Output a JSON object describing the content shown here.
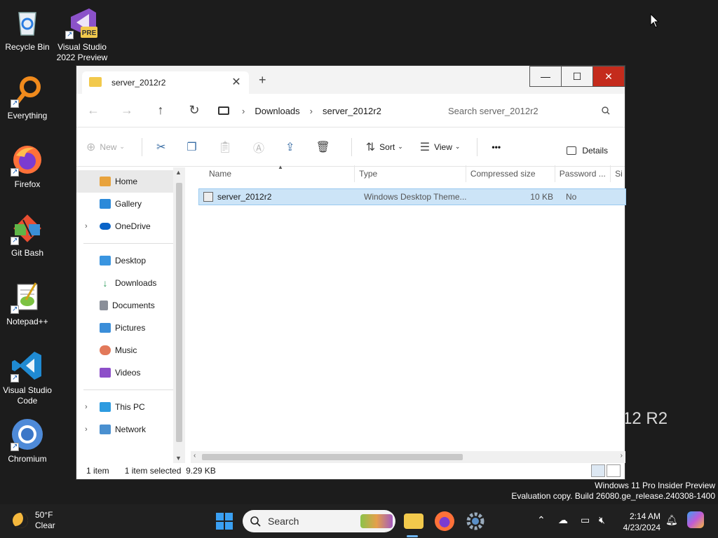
{
  "desktop": {
    "icons": [
      {
        "label": "Recycle Bin"
      },
      {
        "label": "Visual Studio 2022 Preview",
        "badge": "PRE"
      },
      {
        "label": "Everything"
      },
      {
        "label": "Firefox"
      },
      {
        "label": "Git Bash"
      },
      {
        "label": "Notepad++"
      },
      {
        "label": "Visual Studio Code"
      },
      {
        "label": "Chromium"
      }
    ],
    "background_text": "12 R2",
    "watermark_line1": "Windows 11 Pro Insider Preview",
    "watermark_line2": "Evaluation copy. Build 26080.ge_release.240308-1400"
  },
  "window": {
    "tab_title": "server_2012r2",
    "new_tab": "+",
    "buttons": {
      "minimize": "—",
      "maximize": "☐",
      "close": "✕"
    },
    "breadcrumbs": [
      "Downloads",
      "server_2012r2"
    ],
    "search_placeholder": "Search server_2012r2",
    "toolbar": {
      "new": "New",
      "sort": "Sort",
      "view": "View",
      "more": "•••",
      "details": "Details"
    },
    "nav": {
      "home": "Home",
      "gallery": "Gallery",
      "onedrive": "OneDrive",
      "desktop": "Desktop",
      "downloads": "Downloads",
      "documents": "Documents",
      "pictures": "Pictures",
      "music": "Music",
      "videos": "Videos",
      "thispc": "This PC",
      "network": "Network"
    },
    "columns": [
      "Name",
      "Type",
      "Compressed size",
      "Password ...",
      "Si"
    ],
    "files": [
      {
        "name": "server_2012r2",
        "type": "Windows Desktop Theme...",
        "size": "10 KB",
        "password": "No"
      }
    ],
    "status": {
      "count": "1 item",
      "selected": "1 item selected  9.29 KB"
    }
  },
  "taskbar": {
    "weather_temp": "50°F",
    "weather_desc": "Clear",
    "search_placeholder": "Search",
    "time": "2:14 AM",
    "date": "4/23/2024"
  }
}
